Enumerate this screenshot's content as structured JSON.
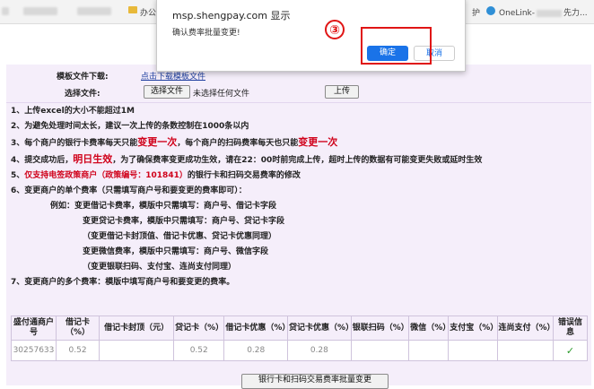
{
  "colors": {
    "accent": "#1a73e8",
    "highlight": "#e01515",
    "warning_text": "#d0021b",
    "panel_bg": "#f5eefa"
  },
  "bookmarks": {
    "folder_label": "办公",
    "right_label": "护",
    "onelink_label": "OneLink-",
    "onelink_tail": "先力..."
  },
  "dialog": {
    "title": "msp.shengpay.com 显示",
    "message": "确认费率批量变更!",
    "ok_label": "确定",
    "cancel_label": "取消",
    "step_number": "③"
  },
  "form": {
    "template_label": "模板文件下载:",
    "template_link": "点击下载模板文件",
    "choose_label": "选择文件:",
    "choose_button": "选择文件",
    "no_file_text": "未选择任何文件",
    "upload_button": "上传"
  },
  "notes": {
    "n1": "1、上传excel的大小不能超过1M",
    "n2": "2、为避免处理时间太长，建议一次上传的条数控制在1000条以内",
    "n3_a": "3、每个商户的银行卡费率每天只能",
    "n3_b": "变更一次",
    "n3_c": "，每个商户的扫码费率每天也只能",
    "n3_d": "变更一次",
    "n4_a": "4、提交成功后，",
    "n4_b": "明日生效",
    "n4_c": "，为了确保费率变更成功生效，请在22：00时前完成上传，超时上传的数据有可能变更失败或延时生效",
    "n5_a": "5、",
    "n5_b": "仅支持电签政策商户（政策编号：101841）",
    "n5_c": "的银行卡和扫码交易费率的修改",
    "n6": "6、变更商户的单个费率（只需填写商户号和要变更的费率即可）：",
    "n6_1": "例如：变更借记卡费率，模版中只需填写：商户号、借记卡字段",
    "n6_2": "变更贷记卡费率，模版中只需填写：商户号、贷记卡字段",
    "n6_3": "（变更借记卡封顶值、借记卡优惠、贷记卡优惠同理）",
    "n6_4": "变更微信费率，模版中只需填写：商户号、微信字段",
    "n6_5": "（变更银联扫码、支付宝、连尚支付同理）",
    "n7": "7、变更商户的多个费率：模版中填写商户号和要变更的费率。"
  },
  "table": {
    "headers": [
      "盛付通商户号",
      "借记卡（%）",
      "借记卡封顶（元）",
      "贷记卡（%）",
      "借记卡优惠（%）",
      "贷记卡优惠（%）",
      "银联扫码（%）",
      "微信（%）",
      "支付宝（%）",
      "连尚支付（%）",
      "错误信息"
    ],
    "row": [
      "30257633",
      "0.52",
      "",
      "0.52",
      "0.28",
      "0.28",
      "",
      "",
      "",
      "",
      ""
    ],
    "status_icon": "check-icon"
  },
  "submit_button": "银行卡和扫码交易费率批量变更"
}
